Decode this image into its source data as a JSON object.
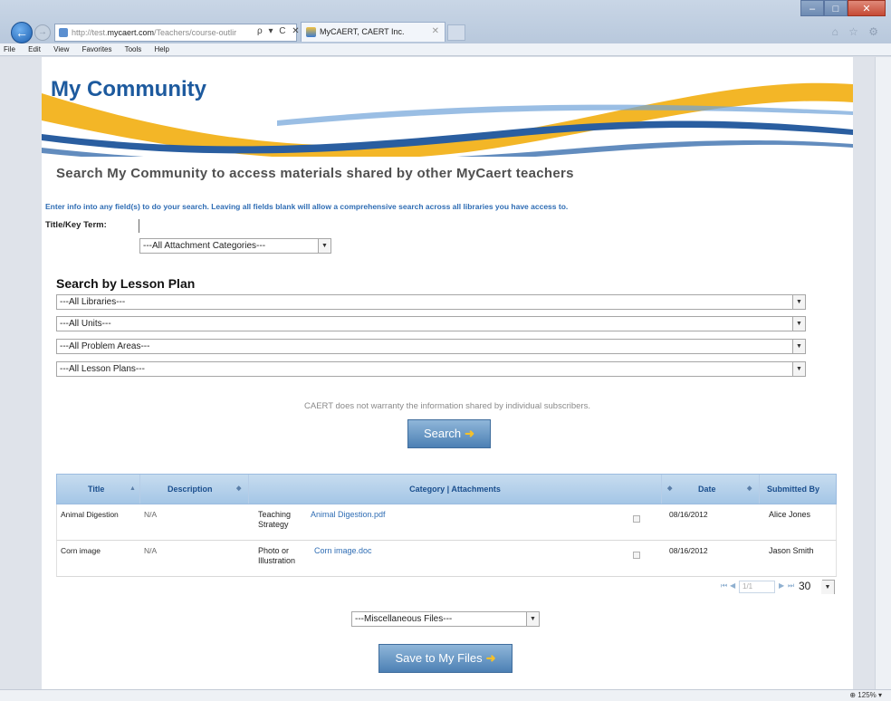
{
  "browser": {
    "url_prefix": "http://test.",
    "url_domain": "mycaert.com",
    "url_path": "/Teachers/course-outlir",
    "addr_controls": "ρ ▾ C ✕",
    "tab_title": "MyCAERT, CAERT Inc.",
    "tab_close": "✕",
    "menu": [
      "File",
      "Edit",
      "View",
      "Favorites",
      "Tools",
      "Help"
    ],
    "window_controls": [
      "–",
      "□",
      "✕"
    ],
    "toolbar_icons": "⌂ ☆ ⚙",
    "zoom": "125%",
    "zoom_label": "⊕ 125% ▾"
  },
  "page": {
    "title": "My Community",
    "heading": "Search My Community to access materials shared by other MyCaert teachers",
    "instructions": "Enter info into any field(s) to do your search. Leaving all fields blank will allow a comprehensive search across all libraries you have access to.",
    "title_key_label": "Title/Key Term:",
    "title_key_value": "",
    "attachment_category": "---All Attachment Categories---",
    "lesson_heading": "Search by Lesson Plan",
    "libraries": "---All Libraries---",
    "units": "---All Units---",
    "problem_areas": "---All Problem Areas---",
    "lesson_plans": "---All Lesson Plans---",
    "disclaimer": "CAERT does not warranty the information shared by individual subscribers.",
    "search_button": "Search",
    "misc_files": "---Miscellaneous Files---",
    "save_button": "Save to My Files"
  },
  "grid": {
    "columns": {
      "title": "Title",
      "description": "Description",
      "category": "Category | Attachments",
      "date": "Date",
      "submitted_by": "Submitted By"
    },
    "rows": [
      {
        "title": "Animal Digestion",
        "description": "N/A",
        "category_line1": "Teaching",
        "category_line2": "Strategy",
        "attachment": "Animal Digestion.pdf",
        "date": "08/16/2012",
        "submitted_by": "Alice Jones"
      },
      {
        "title": "Corn image",
        "description": "N/A",
        "category_line1": "Photo or",
        "category_line2": "Illustration",
        "attachment": "Corn image.doc",
        "date": "08/16/2012",
        "submitted_by": "Jason Smith"
      }
    ],
    "pager": {
      "page_text": "1/1",
      "page_size": "30"
    }
  },
  "colors": {
    "brand_blue": "#1d5a9e",
    "link_blue": "#2f6db4",
    "banner_gold": "#f2b21b",
    "button_arrow": "#f5c02a"
  }
}
